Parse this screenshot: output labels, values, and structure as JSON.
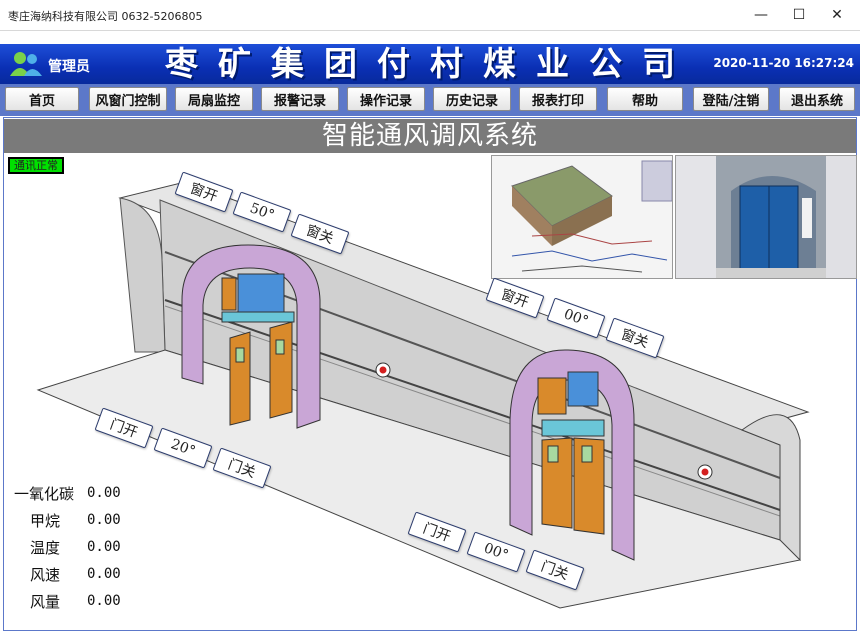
{
  "window": {
    "title": "枣庄海纳科技有限公司   0632-5206805"
  },
  "header": {
    "admin_label": "管理员",
    "company": "枣矿集团付村煤业公司",
    "datetime": "2020-11-20 16:27:24"
  },
  "nav": [
    {
      "label": "首页"
    },
    {
      "label": "风窗门控制"
    },
    {
      "label": "局扇监控"
    },
    {
      "label": "报警记录"
    },
    {
      "label": "操作记录"
    },
    {
      "label": "历史记录"
    },
    {
      "label": "报表打印"
    },
    {
      "label": "帮助"
    },
    {
      "label": "登陆/注销"
    },
    {
      "label": "退出系统"
    }
  ],
  "main": {
    "banner": "智能通风调风系统",
    "comm_status": "通讯正常",
    "labels": {
      "a_open": "窗开",
      "a_angle": "50°",
      "a_close": "窗关",
      "b_open": "窗开",
      "b_angle": "00°",
      "b_close": "窗关",
      "c_open": "门开",
      "c_angle": "20°",
      "c_close": "门关",
      "d_open": "门开",
      "d_angle": "00°",
      "d_close": "门关"
    },
    "sensors": [
      {
        "name": "一氧化碳",
        "value": "0.00"
      },
      {
        "name": "甲烷",
        "value": "0.00"
      },
      {
        "name": "温度",
        "value": "0.00"
      },
      {
        "name": "风速",
        "value": "0.00"
      },
      {
        "name": "风量",
        "value": "0.00"
      }
    ]
  },
  "colors": {
    "header": "#0a2fb4",
    "nav_bar": "#5c78c9",
    "banner": "#7a7a7a",
    "comm_ok": "#00e000",
    "door": "#d98a2b",
    "wall": "#d3d3d3",
    "arch_trim": "#c9a6d6"
  }
}
